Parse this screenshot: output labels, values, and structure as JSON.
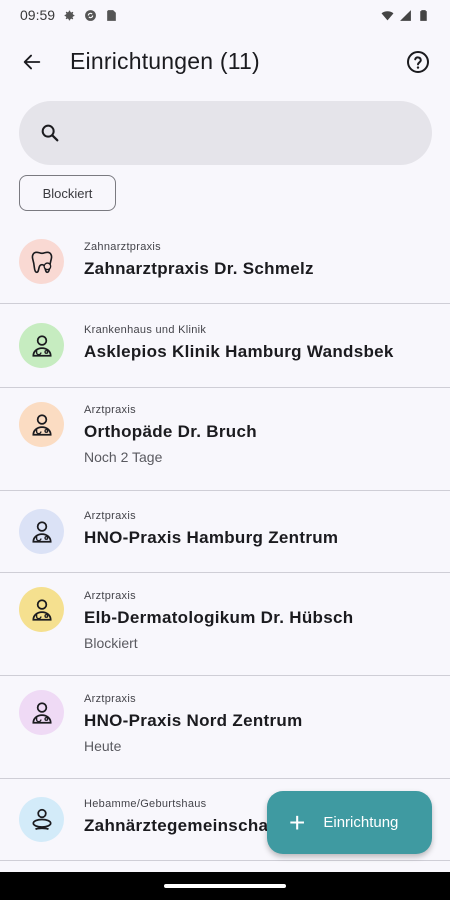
{
  "status_bar": {
    "time": "09:59"
  },
  "app_bar": {
    "title": "Einrichtungen (11)"
  },
  "search": {
    "placeholder": ""
  },
  "filter_chip": {
    "label": "Blockiert"
  },
  "items": [
    {
      "category": "Zahnarztpraxis",
      "name": "Zahnarztpraxis Dr. Schmelz",
      "subtitle": "",
      "avatar_color": "#f9d9d3",
      "icon": "tooth-icon"
    },
    {
      "category": "Krankenhaus und Klinik",
      "name": "Asklepios Klinik Hamburg Wandsbek",
      "subtitle": "",
      "avatar_color": "#c6ecc0",
      "icon": "doctor-icon"
    },
    {
      "category": "Arztpraxis",
      "name": "Orthopäde Dr. Bruch",
      "subtitle": "Noch 2 Tage",
      "avatar_color": "#fbdcc2",
      "icon": "doctor-icon"
    },
    {
      "category": "Arztpraxis",
      "name": "HNO-Praxis Hamburg Zentrum",
      "subtitle": "",
      "avatar_color": "#dbe2f6",
      "icon": "doctor-icon"
    },
    {
      "category": "Arztpraxis",
      "name": "Elb-Dermatologikum Dr. Hübsch",
      "subtitle": "Blockiert",
      "avatar_color": "#f5e08f",
      "icon": "doctor-icon"
    },
    {
      "category": "Arztpraxis",
      "name": "HNO-Praxis Nord Zentrum",
      "subtitle": "Heute",
      "avatar_color": "#efdaf5",
      "icon": "doctor-icon"
    },
    {
      "category": "Hebamme/Geburtshaus",
      "name": "Zahnärztegemeinschaft",
      "subtitle": "",
      "avatar_color": "#d3ebf9",
      "icon": "midwife-icon"
    }
  ],
  "fab": {
    "label": "Einrichtung"
  }
}
